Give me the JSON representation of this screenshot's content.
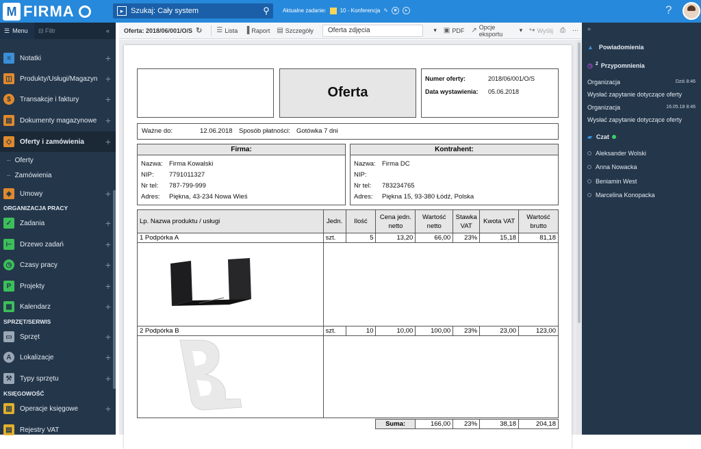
{
  "app": {
    "logo_letter": "M",
    "logo_text": "FIRMA",
    "brand_color": "#2789db"
  },
  "search": {
    "scope": "Szukaj: Cały system"
  },
  "current_task": {
    "label": "Aktualne zadanie:",
    "value": "10 - Konferencja"
  },
  "sidebar": {
    "menu_label": "Menu",
    "filter_placeholder": "Filtr",
    "items": [
      {
        "label": "Notatki",
        "icon": "notes-icon",
        "color": "#3a8fd8"
      },
      {
        "label": "Produkty/Usługi/Magazyn",
        "icon": "box-icon",
        "color": "#e08a2c"
      },
      {
        "label": "Transakcje i faktury",
        "icon": "dollar-icon",
        "color": "#e08a2c"
      },
      {
        "label": "Dokumenty magazynowe",
        "icon": "document-icon",
        "color": "#e08a2c"
      },
      {
        "label": "Oferty i zamówienia",
        "icon": "tag-icon",
        "color": "#e08a2c"
      },
      {
        "label": "Umowy",
        "icon": "handshake-icon",
        "color": "#e08a2c"
      },
      {
        "label": "Zadania",
        "icon": "checkbox-icon",
        "color": "#3cbf5a"
      },
      {
        "label": "Drzewo zadań",
        "icon": "tree-icon",
        "color": "#3cbf5a"
      },
      {
        "label": "Czasy pracy",
        "icon": "clock-icon",
        "color": "#3cbf5a"
      },
      {
        "label": "Projekty",
        "icon": "project-icon",
        "color": "#3cbf5a"
      },
      {
        "label": "Kalendarz",
        "icon": "calendar-icon",
        "color": "#3cbf5a"
      },
      {
        "label": "Sprzęt",
        "icon": "equipment-icon",
        "color": "#9aa7b5"
      },
      {
        "label": "Lokalizacje",
        "icon": "location-icon",
        "color": "#9aa7b5"
      },
      {
        "label": "Typy sprzętu",
        "icon": "equipment-type-icon",
        "color": "#9aa7b5"
      },
      {
        "label": "Operacje księgowe",
        "icon": "ledger-icon",
        "color": "#e0b02c"
      },
      {
        "label": "Rejestry VAT",
        "icon": "vat-icon",
        "color": "#e0b02c"
      }
    ],
    "subitems": [
      "Oferty",
      "Zamówienia"
    ],
    "sections": [
      "ORGANIZACJA PRACY",
      "SPRZĘT/SERWIS",
      "KSIĘGOWOŚĆ"
    ]
  },
  "toolbar": {
    "title": "Oferta: 2018/06/001/O/S",
    "lista": "Lista",
    "raport": "Raport",
    "szczegoly": "Szczegóły",
    "doc": "Oferta zdjęcia",
    "pdf": "PDF",
    "export": "Opcje eksportu",
    "send": "Wyślij"
  },
  "document": {
    "title": "Oferta",
    "number_label": "Numer oferty:",
    "number": "2018/06/001/O/S",
    "date_label": "Data wystawienia:",
    "date": "05.06.2018",
    "valid_label": "Ważne do:",
    "valid": "12.06.2018",
    "payment_label": "Sposób płatności:",
    "payment": "Gotówka 7 dni",
    "seller": {
      "header": "Firma:",
      "rows": [
        {
          "k": "Nazwa:",
          "v": "Firma Kowalski"
        },
        {
          "k": "NIP:",
          "v": "7791011327"
        },
        {
          "k": "Nr tel:",
          "v": "787-799-999"
        },
        {
          "k": "Adres:",
          "v": "Piękna, 43-234 Nowa Wieś"
        }
      ]
    },
    "buyer": {
      "header": "Kontrahent:",
      "rows": [
        {
          "k": "Nazwa:",
          "v": "Firma DC"
        },
        {
          "k": "NIP:",
          "v": ""
        },
        {
          "k": "Nr tel:",
          "v": "783234765"
        },
        {
          "k": "Adres:",
          "v": "Piękna 15, 93-380 Łódź, Polska"
        }
      ]
    },
    "columns": [
      "Lp. Nazwa produktu / usługi",
      "Jedn.",
      "Ilość",
      "Cena jedn. netto",
      "Wartość netto",
      "Stawka VAT",
      "Kwota VAT",
      "Wartość brutto"
    ],
    "items": [
      {
        "name": "1  Podpórka A",
        "unit": "szt.",
        "qty": "5",
        "price": "13,20",
        "net": "66,00",
        "rate": "23%",
        "vat": "15,18",
        "gross": "81,18"
      },
      {
        "name": "2  Podpórka B",
        "unit": "szt.",
        "qty": "10",
        "price": "10,00",
        "net": "100,00",
        "rate": "23%",
        "vat": "23,00",
        "gross": "123,00"
      }
    ],
    "sum": {
      "label": "Suma:",
      "net": "166,00",
      "rate": "23%",
      "vat": "38,18",
      "gross": "204,18"
    }
  },
  "right_panel": {
    "notifications": "Powiadomienia",
    "reminders": "Przypomnienia",
    "reminder_badge": "2",
    "reminder_items": [
      {
        "org": "Organizacja",
        "time": "Dziś 8:46",
        "text": "Wysłać zapytanie dotyczące oferty"
      },
      {
        "org": "Organizacja",
        "time": "16.05.18 8:46",
        "text": "Wysłać zapytanie dotyczące oferty"
      }
    ],
    "chat": "Czat",
    "contacts": [
      "Aleksander Wolski",
      "Anna Nowacka",
      "Beniamin West",
      "Marcelina Konopacka"
    ]
  }
}
